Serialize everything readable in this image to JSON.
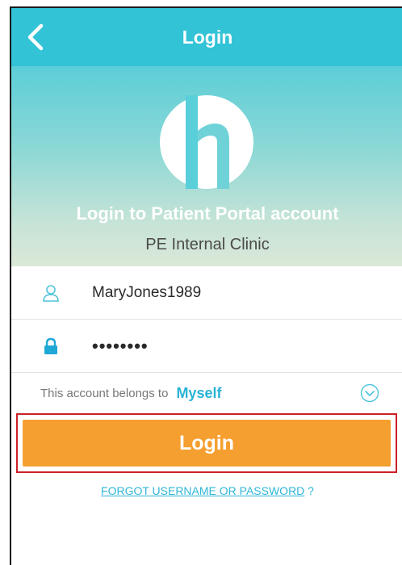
{
  "header": {
    "title": "Login",
    "back_icon": "chevron-left-icon"
  },
  "hero": {
    "logo_icon": "h-logo-icon",
    "heading": "Login to Patient Portal account",
    "clinic_name": "PE Internal Clinic"
  },
  "form": {
    "username": {
      "value": "MaryJones1989",
      "icon": "user-icon"
    },
    "password": {
      "value": "••••••••",
      "icon": "lock-icon"
    },
    "belongs_label": "This account belongs to",
    "belongs_value": "Myself",
    "belongs_icon": "chevron-down-circle-icon",
    "login_label": "Login",
    "forgot_link": "FORGOT USERNAME OR PASSWORD",
    "forgot_suffix": " ?"
  },
  "colors": {
    "header": "#32c3d6",
    "accent": "#29b3d6",
    "login_button": "#f59f30",
    "highlight_border": "#cc2027"
  }
}
